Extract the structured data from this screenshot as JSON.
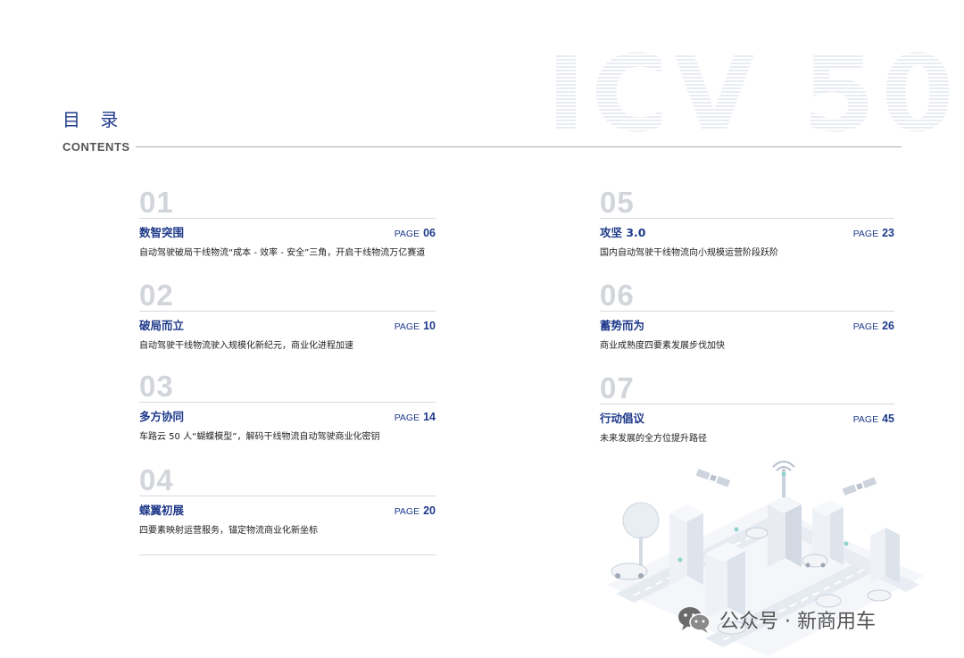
{
  "watermark": "ICV 50",
  "header": {
    "title": "目 录",
    "subtitle": "CONTENTS"
  },
  "page_label": "PAGE",
  "sections": [
    {
      "num": "01",
      "name": "数智突围",
      "page": "06",
      "desc": "自动驾驶破局干线物流“成本 - 效率 - 安全”三角，开启干线物流万亿赛道"
    },
    {
      "num": "02",
      "name": "破局而立",
      "page": "10",
      "desc": "自动驾驶干线物流驶入规模化新纪元，商业化进程加速"
    },
    {
      "num": "03",
      "name": "多方协同",
      "page": "14",
      "desc": "车路云 50 人“蝴蝶模型”，解码干线物流自动驾驶商业化密钥"
    },
    {
      "num": "04",
      "name": "蝶翼初展",
      "page": "20",
      "desc": "四要素映射运营服务，锚定物流商业化新坐标"
    },
    {
      "num": "05",
      "name": "攻坚 3.0",
      "page": "23",
      "desc": "国内自动驾驶干线物流向小规模运营阶段跃阶"
    },
    {
      "num": "06",
      "name": "蓄势而为",
      "page": "26",
      "desc": "商业成熟度四要素发展步伐加快"
    },
    {
      "num": "07",
      "name": "行动倡议",
      "page": "45",
      "desc": "未来发展的全方位提升路径"
    }
  ],
  "footer": {
    "text": "公众号 · 新商用车"
  }
}
